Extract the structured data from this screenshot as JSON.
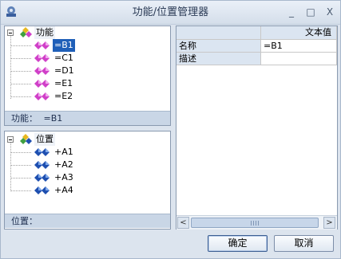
{
  "window": {
    "title": "功能/位置管理器",
    "minimize_glyph": "_",
    "maximize_glyph": "□",
    "close_glyph": "X"
  },
  "function_tree": {
    "root_label": "功能",
    "items": [
      "=B1",
      "=C1",
      "=D1",
      "=E1",
      "=E2"
    ],
    "selected_index": 0,
    "item_icon": "pink-diamond-icon"
  },
  "function_status": {
    "label": "功能：",
    "value": "=B1"
  },
  "location_tree": {
    "root_label": "位置",
    "items": [
      "+A1",
      "+A2",
      "+A3",
      "+A4"
    ],
    "item_icon": "blue-diamond-icon"
  },
  "location_status": {
    "label": "位置："
  },
  "property_grid": {
    "value_header": "文本值",
    "rows": [
      {
        "name": "名称",
        "value": "=B1"
      },
      {
        "name": "描述",
        "value": ""
      }
    ]
  },
  "scrollbar": {
    "left_arrow": "<",
    "right_arrow": ">"
  },
  "buttons": {
    "ok": "确定",
    "cancel": "取消"
  },
  "colors": {
    "selection": "#1f5fb8",
    "status_bar": "#c9d6e6",
    "pink_diamond": "#d040c8",
    "blue_diamond": "#1e4fb0"
  }
}
